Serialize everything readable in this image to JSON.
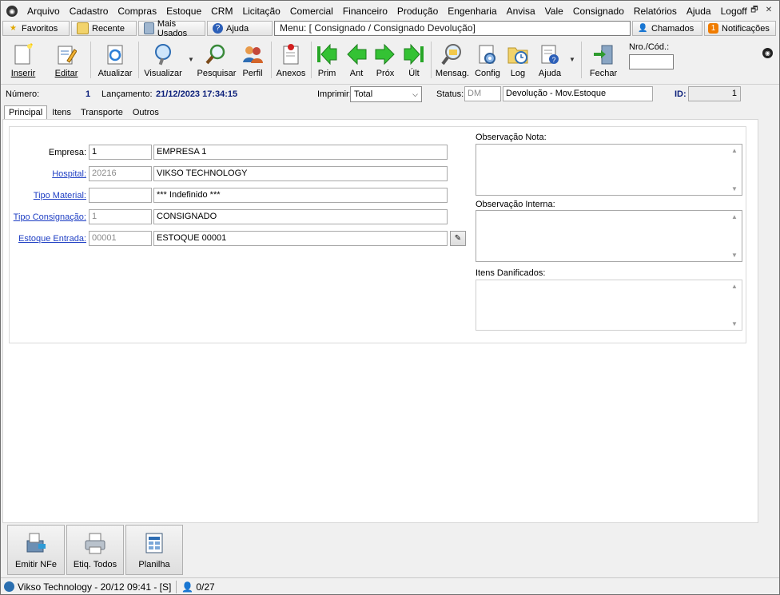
{
  "menubar": {
    "items": [
      "Arquivo",
      "Cadastro",
      "Compras",
      "Estoque",
      "CRM",
      "Licitação",
      "Comercial",
      "Financeiro",
      "Produção",
      "Engenharia",
      "Anvisa",
      "Vale",
      "Consignado",
      "Relatórios",
      "Ajuda",
      "Logoff"
    ]
  },
  "window": {
    "minimize": "_",
    "restore": "🗗",
    "close": "✕"
  },
  "quickbar": {
    "favoritos": "Favoritos",
    "recente": "Recente",
    "mais_usados": "Mais Usados",
    "ajuda": "Ajuda",
    "menu_path": "Menu: [ Consignado / Consignado Devolução]",
    "chamados": "Chamados",
    "notificacoes": "Notificações",
    "notif_count": "1"
  },
  "toolbar": {
    "inserir": "Inserir",
    "editar": "Editar",
    "atualizar": "Atualizar",
    "visualizar": "Visualizar",
    "pesquisar": "Pesquisar",
    "perfil": "Perfil",
    "anexos": "Anexos",
    "prim": "Prim",
    "ant": "Ant",
    "prox": "Próx",
    "ult": "Últ",
    "mensag": "Mensag.",
    "config": "Config",
    "log": "Log",
    "ajuda": "Ajuda",
    "fechar": "Fechar",
    "nro_cod_label": "Nro./Cód.:"
  },
  "header": {
    "numero_label": "Número:",
    "numero_value": "1",
    "lancamento_label": "Lançamento:",
    "lancamento_value": "21/12/2023 17:34:15",
    "imprimir_label": "Imprimir:",
    "imprimir_value": "Total",
    "status_label": "Status:",
    "status_code": "DM",
    "status_desc": "Devolução - Mov.Estoque",
    "id_label": "ID:",
    "id_value": "1"
  },
  "tabs": [
    "Principal",
    "Itens",
    "Transporte",
    "Outros"
  ],
  "form": {
    "empresa": {
      "label": "Empresa:",
      "code": "1",
      "desc": "EMPRESA 1"
    },
    "hospital": {
      "label": "Hospital:",
      "code": "20216",
      "desc": "VIKSO TECHNOLOGY"
    },
    "tipo_material": {
      "label": "Tipo Material:",
      "code": "",
      "desc": "*** Indefinido ***"
    },
    "tipo_consignacao": {
      "label": "Tipo Consignação:",
      "code": "1",
      "desc": "CONSIGNADO"
    },
    "estoque_entrada": {
      "label": "Estoque Entrada:",
      "code": "00001",
      "desc": "ESTOQUE 00001"
    },
    "obs_nota_label": "Observação Nota:",
    "obs_interna_label": "Observação Interna:",
    "itens_danificados_label": "Itens Danificados:"
  },
  "bottom": {
    "emitir_nfe": "Emitir NFe",
    "etiq_todos": "Etiq. Todos",
    "planilha": "Planilha"
  },
  "statusbar": {
    "company": "Vikso Technology - 20/12 09:41 - [S]",
    "users": "0/27"
  }
}
